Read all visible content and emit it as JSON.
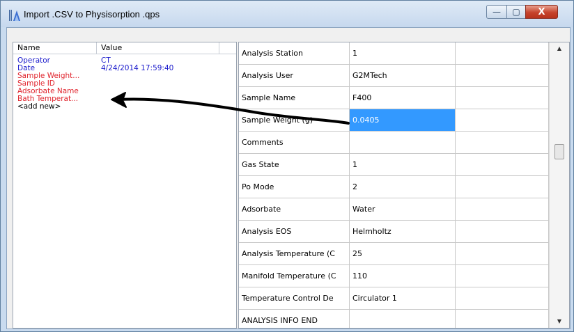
{
  "window": {
    "title": "Import .CSV to Physisorption .qps",
    "minimize_glyph": "—",
    "maximize_glyph": "▢",
    "close_glyph": "X"
  },
  "colors": {
    "blue_text": "#1a1acc",
    "red_text": "#e0242d",
    "selected_bg": "#3399ff",
    "arrow": "#000000"
  },
  "icons": {
    "app": "qps-import-icon",
    "scroll_up": "scroll-up-arrow-icon",
    "scroll_down": "scroll-down-arrow-icon"
  },
  "left_list": {
    "headers": {
      "name": "Name",
      "value": "Value"
    },
    "rows": [
      {
        "name": "Operator",
        "value": "CT",
        "color": "blue"
      },
      {
        "name": "Date",
        "value": "4/24/2014 17:59:40",
        "color": "blue"
      },
      {
        "name": "Sample Weight...",
        "value": "",
        "color": "red"
      },
      {
        "name": "Sample ID",
        "value": "",
        "color": "red"
      },
      {
        "name": "Adsorbate Name",
        "value": "",
        "color": "red"
      },
      {
        "name": "Bath Temperat...",
        "value": "",
        "color": "red"
      },
      {
        "name": "<add new>",
        "value": "",
        "color": "black"
      }
    ]
  },
  "grid": {
    "rows": [
      {
        "key": "Analysis Station",
        "value": "1"
      },
      {
        "key": "Analysis User",
        "value": "G2MTech"
      },
      {
        "key": "Sample Name",
        "value": "F400"
      },
      {
        "key": "Sample Weight (g)",
        "value": "0.0405",
        "selected": true
      },
      {
        "key": "Comments",
        "value": ""
      },
      {
        "key": "Gas State",
        "value": "1"
      },
      {
        "key": "Po Mode",
        "value": "2"
      },
      {
        "key": "Adsorbate",
        "value": "Water"
      },
      {
        "key": "Analysis EOS",
        "value": "Helmholtz"
      },
      {
        "key": "Analysis Temperature (C",
        "value": "25"
      },
      {
        "key": "Manifold Temperature (C",
        "value": "110"
      },
      {
        "key": "Temperature Control De",
        "value": "Circulator 1"
      },
      {
        "key": "ANALYSIS INFO END",
        "value": ""
      }
    ]
  }
}
